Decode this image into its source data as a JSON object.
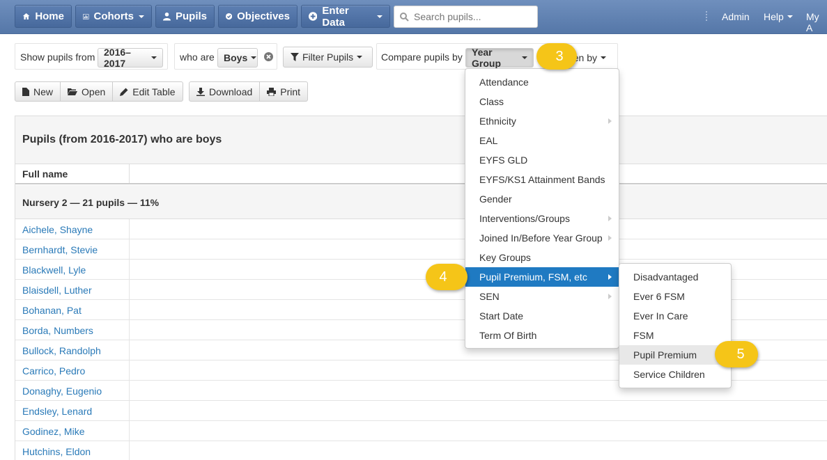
{
  "navbar": {
    "home": "Home",
    "cohorts": "Cohorts",
    "pupils": "Pupils",
    "objectives": "Objectives",
    "enter_data": "Enter Data",
    "search_placeholder": "Search pupils...",
    "admin": "Admin",
    "help": "Help",
    "my_account": "My A"
  },
  "filters": {
    "show_from_label": "Show pupils from",
    "year_value": "2016–2017",
    "who_are_label": "who are",
    "gender_value": "Boys",
    "filter_button": "Filter Pupils",
    "compare_label": "Compare pupils by",
    "compare_value": "Year Group",
    "then_by_label": "en by"
  },
  "toolbar": {
    "new": "New",
    "open": "Open",
    "edit_table": "Edit Table",
    "download": "Download",
    "print": "Print"
  },
  "table": {
    "title": "Pupils (from 2016-2017) who are boys",
    "col_full_name": "Full name",
    "group_label": "Nursery 2 — 21 pupils — 11%",
    "pupils": [
      "Aichele, Shayne",
      "Bernhardt, Stevie",
      "Blackwell, Lyle",
      "Blaisdell, Luther",
      "Bohanan, Pat",
      "Borda, Numbers",
      "Bullock, Randolph",
      "Carrico, Pedro",
      "Donaghy, Eugenio",
      "Endsley, Lenard",
      "Godinez, Mike",
      "Hutchins, Eldon"
    ]
  },
  "compare_menu": {
    "items": [
      {
        "label": "Attendance",
        "submenu": false
      },
      {
        "label": "Class",
        "submenu": false
      },
      {
        "label": "Ethnicity",
        "submenu": true
      },
      {
        "label": "EAL",
        "submenu": false
      },
      {
        "label": "EYFS GLD",
        "submenu": false
      },
      {
        "label": "EYFS/KS1 Attainment Bands",
        "submenu": false
      },
      {
        "label": "Gender",
        "submenu": false
      },
      {
        "label": "Interventions/Groups",
        "submenu": true
      },
      {
        "label": "Joined In/Before Year Group",
        "submenu": true
      },
      {
        "label": "Key Groups",
        "submenu": false
      },
      {
        "label": "Pupil Premium, FSM, etc",
        "submenu": true
      },
      {
        "label": "SEN",
        "submenu": true
      },
      {
        "label": "Start Date",
        "submenu": false
      },
      {
        "label": "Term Of Birth",
        "submenu": false
      }
    ],
    "active_index": 10
  },
  "sub_menu": {
    "items": [
      "Disadvantaged",
      "Ever 6 FSM",
      "Ever In Care",
      "FSM",
      "Pupil Premium",
      "Service Children"
    ],
    "hover_index": 4
  },
  "callouts": {
    "step3": "3",
    "step4": "4",
    "step5": "5"
  },
  "colors": {
    "navbar": "#5d7fb2",
    "link": "#2a7ab8",
    "menu_active": "#1f7ac2",
    "callout": "#f5c518"
  }
}
